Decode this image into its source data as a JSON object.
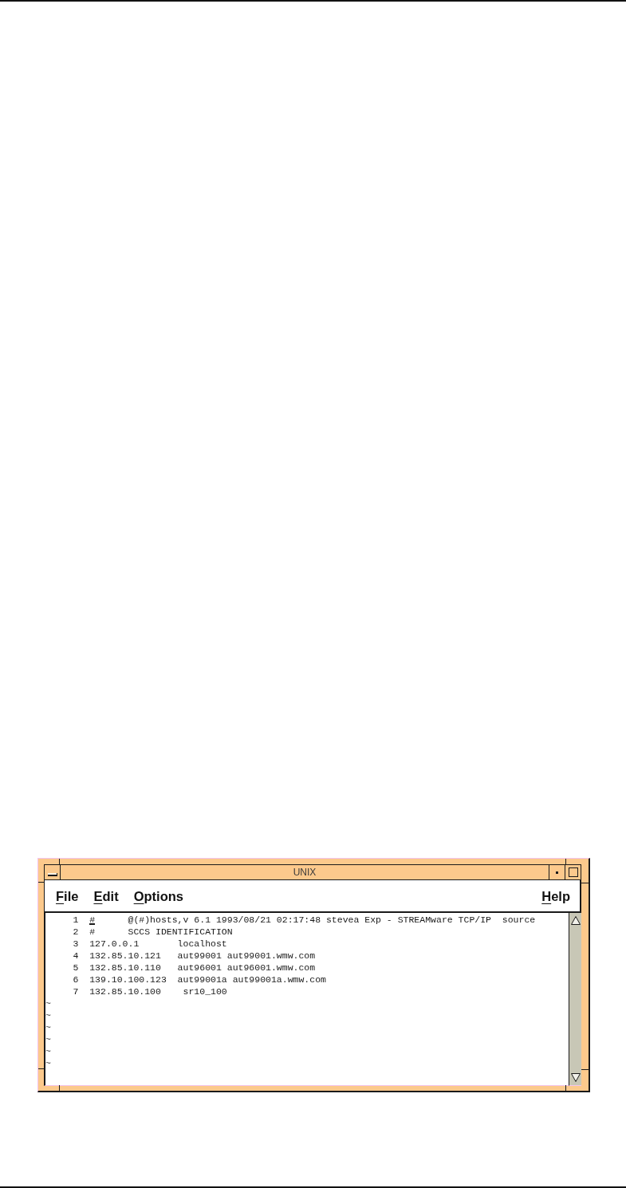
{
  "window": {
    "title": "UNIX"
  },
  "menu_bar": {
    "items": [
      {
        "label": "File"
      },
      {
        "label": "Edit"
      },
      {
        "label": "Options"
      }
    ],
    "help": {
      "label": "Help"
    }
  },
  "editor": {
    "lines": [
      {
        "number": "1",
        "text": "#      @(#)hosts,v 6.1 1993/08/21 02:17:48 stevea Exp - STREAMware TCP/IP  source",
        "cursor": true
      },
      {
        "number": "2",
        "text": "#      SCCS IDENTIFICATION",
        "cursor": false
      },
      {
        "number": "3",
        "text": "127.0.0.1       localhost",
        "cursor": false
      },
      {
        "number": "4",
        "text": "132.85.10.121   aut99001 aut99001.wmw.com",
        "cursor": false
      },
      {
        "number": "5",
        "text": "132.85.10.110   aut96001 aut96001.wmw.com",
        "cursor": false
      },
      {
        "number": "6",
        "text": "139.10.100.123  aut99001a aut99001a.wmw.com",
        "cursor": false
      },
      {
        "number": "7",
        "text": "132.85.10.100    sr10_100",
        "cursor": false
      }
    ],
    "empty_lines": [
      "~",
      "~",
      "~",
      "~",
      "~",
      "~"
    ]
  }
}
